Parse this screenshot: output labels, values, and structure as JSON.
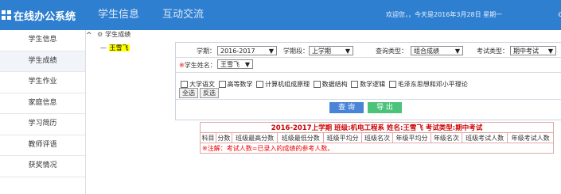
{
  "app": {
    "title": "在线办公系统"
  },
  "nav": {
    "items": [
      {
        "label": "学生信息"
      },
      {
        "label": "互动交流"
      }
    ]
  },
  "header": {
    "welcome": "欢迎您，，今天是2016年3月28日 星期一",
    "corner": "c"
  },
  "sidebar": {
    "items": [
      {
        "label": "学生信息"
      },
      {
        "label": "学生成绩"
      },
      {
        "label": "学生作业"
      },
      {
        "label": "家庭信息"
      },
      {
        "label": "学习简历"
      },
      {
        "label": "教师评语"
      },
      {
        "label": "获奖情况"
      }
    ],
    "collapse_glyph": "^"
  },
  "breadcrumb": {
    "label": "学生成绩"
  },
  "tree": {
    "prefix": "—",
    "student": "王雪飞"
  },
  "filters": {
    "term_label": "学期：",
    "term_value": "2016-2017",
    "period_label": "学期段：",
    "period_value": "上学期",
    "query_label": "查询类型：",
    "query_value": "组合成绩",
    "exam_label": "考试类型：",
    "exam_value": "期中考试",
    "student_req": "※",
    "student_label": "学生姓名：",
    "student_value": "王雪飞"
  },
  "courses": [
    "大学语文",
    "高等数学",
    "计算机组成原理",
    "数据结构",
    "数学逻辑",
    "毛泽东思想和邓小平理论"
  ],
  "buttons": {
    "select_all": "全选",
    "invert": "反选",
    "query": "查 询",
    "export": "导 出"
  },
  "colors": {
    "header": "#2e7fd0",
    "query": "#4a84d6",
    "export": "#4cc37a",
    "table_border": "#e0a8a8",
    "title_red": "#cc0000"
  },
  "result": {
    "title": "2016-2017上学期  班级:机电工程系  姓名:王雪飞  考试类型:期中考试",
    "headers": [
      "科目",
      "分数",
      "班级最高分数",
      "班级最低分数",
      "班级平均分",
      "班级名次",
      "年级平均分",
      "年级名次",
      "班级考试人数",
      "年级考试人数"
    ],
    "note": "※注解：考试人数=已录入的成绩的参考人数。"
  }
}
